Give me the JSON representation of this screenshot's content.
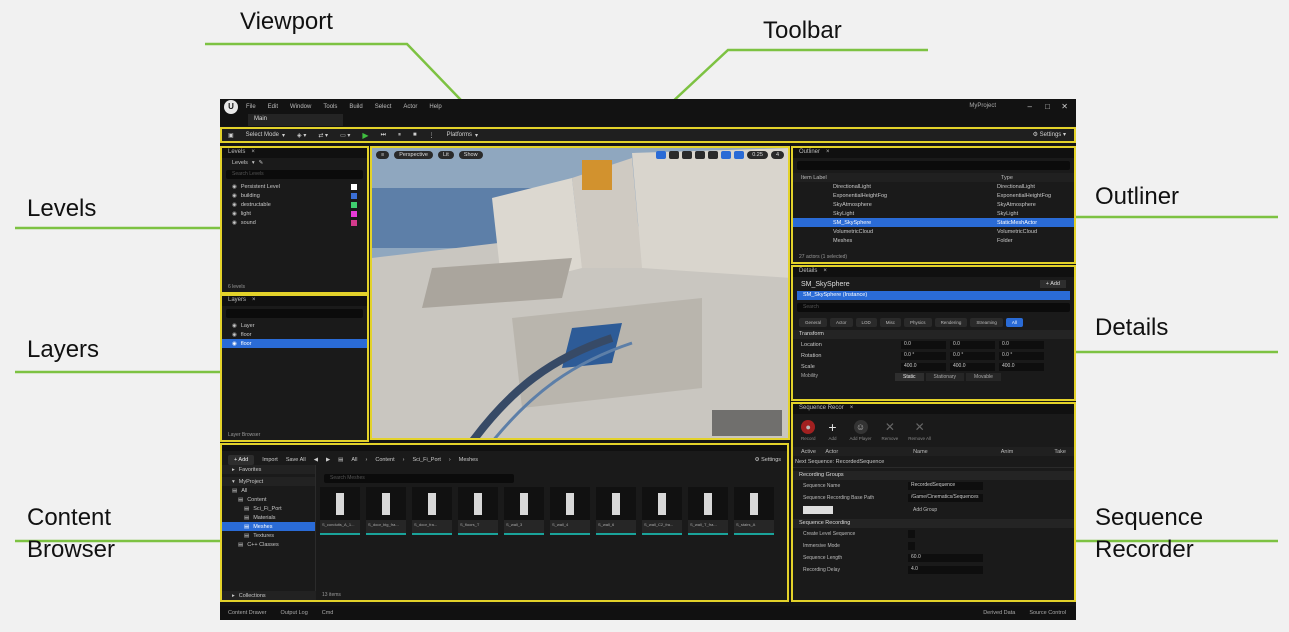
{
  "callouts": {
    "viewport": "Viewport",
    "toolbar": "Toolbar",
    "levels": "Levels",
    "outliner": "Outliner",
    "layers": "Layers",
    "details": "Details",
    "content_browser_1": "Content",
    "content_browser_2": "Browser",
    "sequence_recorder_1": "Sequence",
    "sequence_recorder_2": "Recorder"
  },
  "colors": {
    "highlight": "#e3d22a",
    "callout_line": "#7dc242",
    "selection": "#2a6bd6"
  },
  "menu": [
    "File",
    "Edit",
    "Window",
    "Tools",
    "Build",
    "Select",
    "Actor",
    "Help"
  ],
  "project_name": "MyProject",
  "level_tab": "Main",
  "toolbar": {
    "mode": "Select Mode",
    "platforms": "Platforms",
    "settings": "Settings"
  },
  "levels": {
    "title": "Levels",
    "dropdown": "Levels",
    "search_placeholder": "Search Levels",
    "items": [
      {
        "name": "Persistent Level",
        "color": "#ffffff"
      },
      {
        "name": "building",
        "color": "#3b6fd6"
      },
      {
        "name": "destructable",
        "color": "#3fcf6f"
      },
      {
        "name": "light",
        "color": "#e83ad8"
      },
      {
        "name": "sound",
        "color": "#d43a8c"
      }
    ],
    "footer": "6 levels"
  },
  "layers": {
    "title": "Layers",
    "items": [
      "Layer",
      "floor",
      "floor"
    ],
    "footer": "Layer Browser"
  },
  "viewport": {
    "view": "Perspective",
    "lit": "Lit",
    "show": "Show",
    "speed": "0.25",
    "cam": "4"
  },
  "outliner": {
    "title": "Outliner",
    "columns": [
      "Item Label",
      "Type"
    ],
    "rows": [
      {
        "label": "DirectionalLight",
        "type": "DirectionalLight",
        "sel": false
      },
      {
        "label": "ExponentialHeightFog",
        "type": "ExponentialHeightFog",
        "sel": false
      },
      {
        "label": "SkyAtmosphere",
        "type": "SkyAtmosphere",
        "sel": false
      },
      {
        "label": "SkyLight",
        "type": "SkyLight",
        "sel": false
      },
      {
        "label": "SM_SkySphere",
        "type": "StaticMeshActor",
        "sel": true
      },
      {
        "label": "VolumetricCloud",
        "type": "VolumetricCloud",
        "sel": false
      },
      {
        "label": "Meshes",
        "type": "Folder",
        "sel": false
      }
    ],
    "footer": "27 actors (1 selected)"
  },
  "details": {
    "title": "Details",
    "actor": "SM_SkySphere",
    "add": "+ Add",
    "instance": "SM_SkySphere (Instance)",
    "search_placeholder": "Search",
    "filters": [
      "General",
      "Actor",
      "LOD",
      "Misc",
      "Physics",
      "Rendering",
      "Streaming",
      "All"
    ],
    "section": "Transform",
    "props": [
      {
        "label": "Location",
        "x": "0.0",
        "y": "0.0",
        "z": "0.0"
      },
      {
        "label": "Rotation",
        "x": "0.0 °",
        "y": "0.0 °",
        "z": "0.0 °"
      },
      {
        "label": "Scale",
        "x": "400.0",
        "y": "400.0",
        "z": "400.0"
      }
    ],
    "mobility_label": "Mobility",
    "mobility": [
      "Static",
      "Stationary",
      "Movable"
    ]
  },
  "sequence": {
    "title": "Sequence Recor",
    "tools": [
      "Record",
      "Add",
      "Add Player",
      "Remove",
      "Remove All"
    ],
    "columns": [
      "Active",
      "Actor",
      "Name",
      "Anim",
      "Take"
    ],
    "next": "Next Sequence: RecordedSequence",
    "section1": "Recording Groups",
    "fields": [
      {
        "label": "Sequence Name",
        "value": "RecordedSequence"
      },
      {
        "label": "Sequence Recording Base Path",
        "value": "/Game/Cinematics/Sequences"
      }
    ],
    "add_group": "Add Group",
    "section2": "Sequence Recording",
    "fields2": [
      {
        "label": "Create Level Sequence",
        "value": ""
      },
      {
        "label": "Immersive Mode",
        "value": ""
      },
      {
        "label": "Sequence Length",
        "value": "60.0"
      },
      {
        "label": "Recording Delay",
        "value": "4.0"
      }
    ]
  },
  "content": {
    "add": "+ Add",
    "import": "Import",
    "save_all": "Save All",
    "path": [
      "All",
      "Content",
      "Sci_Fi_Port",
      "Meshes"
    ],
    "settings": "Settings",
    "favorites": "Favorites",
    "project": "MyProject",
    "tree": [
      "All",
      "Content",
      "Sci_Fi_Port",
      "Materials",
      "Meshes",
      "Textures",
      "C++ Classes"
    ],
    "collections": "Collections",
    "search_placeholder": "Search Meshes",
    "assets": [
      "S_conduits_A_1...",
      "S_door_big_fra...",
      "S_door_fra...",
      "S_floors_T",
      "S_wall_3",
      "S_wall_4",
      "S_wall_6",
      "S_wall_C2_fra...",
      "S_wall_T_fra...",
      "S_stairs_A"
    ],
    "footer": "13 items"
  },
  "status": [
    "Content Drawer",
    "Output Log",
    "Cmd",
    "Derived Data",
    "Source Control"
  ]
}
